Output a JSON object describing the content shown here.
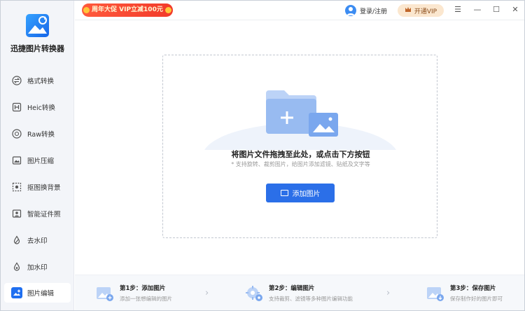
{
  "app": {
    "name": "迅捷图片转换器"
  },
  "promo": {
    "text": "周年大促 VIP立减100元"
  },
  "header": {
    "login_label": "登录/注册",
    "vip_label": "开通VIP"
  },
  "window_controls": {
    "menu": "☰",
    "minimize": "—",
    "maximize": "☐",
    "close": "✕"
  },
  "sidebar": {
    "items": [
      {
        "label": "格式转换",
        "icon": "convert-icon"
      },
      {
        "label": "Heic转换",
        "icon": "heic-icon"
      },
      {
        "label": "Raw转换",
        "icon": "raw-icon"
      },
      {
        "label": "图片压缩",
        "icon": "compress-icon"
      },
      {
        "label": "抠图换背景",
        "icon": "cutout-icon"
      },
      {
        "label": "智能证件照",
        "icon": "id-photo-icon"
      },
      {
        "label": "去水印",
        "icon": "remove-watermark-icon"
      },
      {
        "label": "加水印",
        "icon": "add-watermark-icon"
      },
      {
        "label": "图片编辑",
        "icon": "image-edit-icon",
        "active": true
      }
    ]
  },
  "dropzone": {
    "title": "将图片文件拖拽至此处，或点击下方按钮",
    "subtitle": "* 支持旋转、裁剪图片，给图片添加滤镜、贴纸及文字等",
    "button_label": "添加图片"
  },
  "steps": [
    {
      "title": "第1步：添加图片",
      "desc": "添加一张想编辑的图片"
    },
    {
      "title": "第2步：编辑图片",
      "desc": "支持裁剪、滤镜等多种图片编辑功能"
    },
    {
      "title": "第3步：保存图片",
      "desc": "保存制作好的图片即可"
    }
  ],
  "colors": {
    "accent": "#2b6fe8",
    "promo": "#f23a2a",
    "vip_bg": "#fbe7cf"
  }
}
